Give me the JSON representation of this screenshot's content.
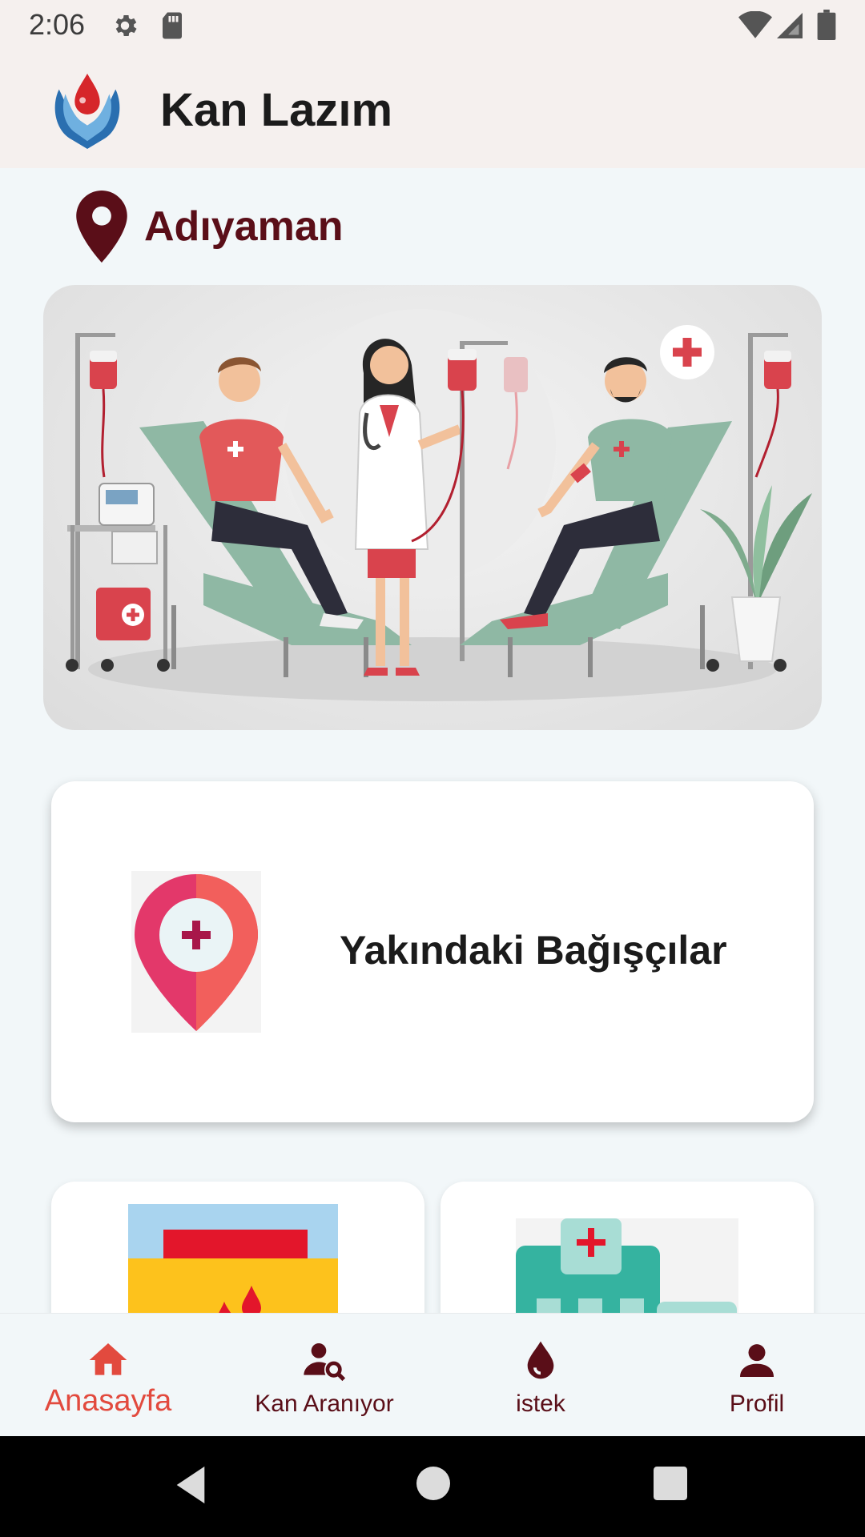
{
  "status_bar": {
    "time": "2:06",
    "icons": [
      "gear-icon",
      "sd-card-icon",
      "wifi-icon",
      "signal-icon",
      "battery-icon"
    ]
  },
  "app_bar": {
    "title": "Kan Lazım",
    "logo": "blood-drop-hands-logo"
  },
  "location": {
    "icon": "location-pin-icon",
    "city": "Adıyaman"
  },
  "banner": {
    "illustration": "blood-donation-illustration"
  },
  "nearby_card": {
    "icon": "location-plus-icon",
    "label": "Yakındaki Bağışçılar"
  },
  "mini_cards": [
    {
      "icon": "blood-bag-icon"
    },
    {
      "icon": "hospital-icon"
    }
  ],
  "bottom_nav": {
    "items": [
      {
        "label": "Anasayfa",
        "icon": "home-icon",
        "active": true
      },
      {
        "label": "Kan Aranıyor",
        "icon": "person-search-icon",
        "active": false
      },
      {
        "label": "istek",
        "icon": "blood-drop-icon",
        "active": false
      },
      {
        "label": "Profil",
        "icon": "person-icon",
        "active": false
      }
    ]
  },
  "colors": {
    "accent": "#e24a3e",
    "dark_red": "#5a0e18",
    "background": "#f2f7f9",
    "app_bar": "#f5f0ee"
  }
}
